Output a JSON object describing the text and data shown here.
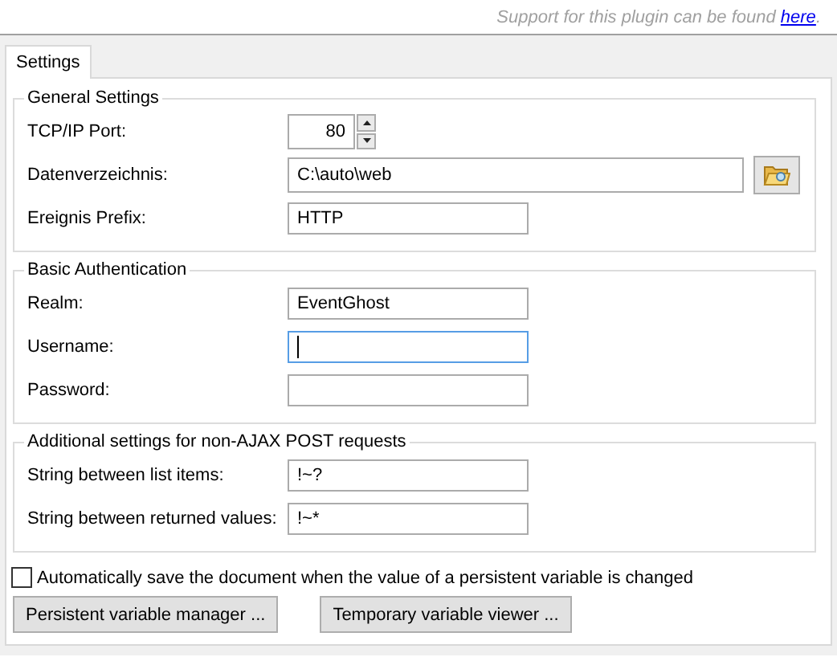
{
  "support": {
    "text": "Support for this plugin can be found ",
    "link": "here",
    "end": "."
  },
  "tabs": [
    {
      "label": "Settings",
      "selected": true
    }
  ],
  "groups": [
    {
      "title": "General Settings",
      "fields": [
        {
          "kind": "spin",
          "label": "TCP/IP Port:",
          "value": "80",
          "focused": false
        },
        {
          "kind": "path",
          "label": "Datenverzeichnis:",
          "value": "C:\\auto\\web",
          "focused": false
        },
        {
          "kind": "text",
          "label": "Ereignis Prefix:",
          "value": "HTTP",
          "focused": false
        }
      ]
    },
    {
      "title": "Basic Authentication",
      "fields": [
        {
          "kind": "text",
          "label": "Realm:",
          "value": "EventGhost",
          "focused": false
        },
        {
          "kind": "text",
          "label": "Username:",
          "focused": true
        },
        {
          "kind": "text",
          "label": "Password:",
          "focused": false
        }
      ]
    },
    {
      "title": "Additional settings for non-AJAX POST requests",
      "fields": [
        {
          "kind": "text",
          "label": "String between list items:",
          "value": "!~?",
          "focused": false
        },
        {
          "kind": "text",
          "label": "String between returned values:",
          "value": "!~*",
          "focused": false
        }
      ]
    }
  ],
  "autosave": {
    "label": "Automatically save the document when the value of a persistent variable is changed",
    "checked": false
  },
  "buttons": [
    "Persistent variable manager ...",
    "Temporary variable viewer ..."
  ]
}
